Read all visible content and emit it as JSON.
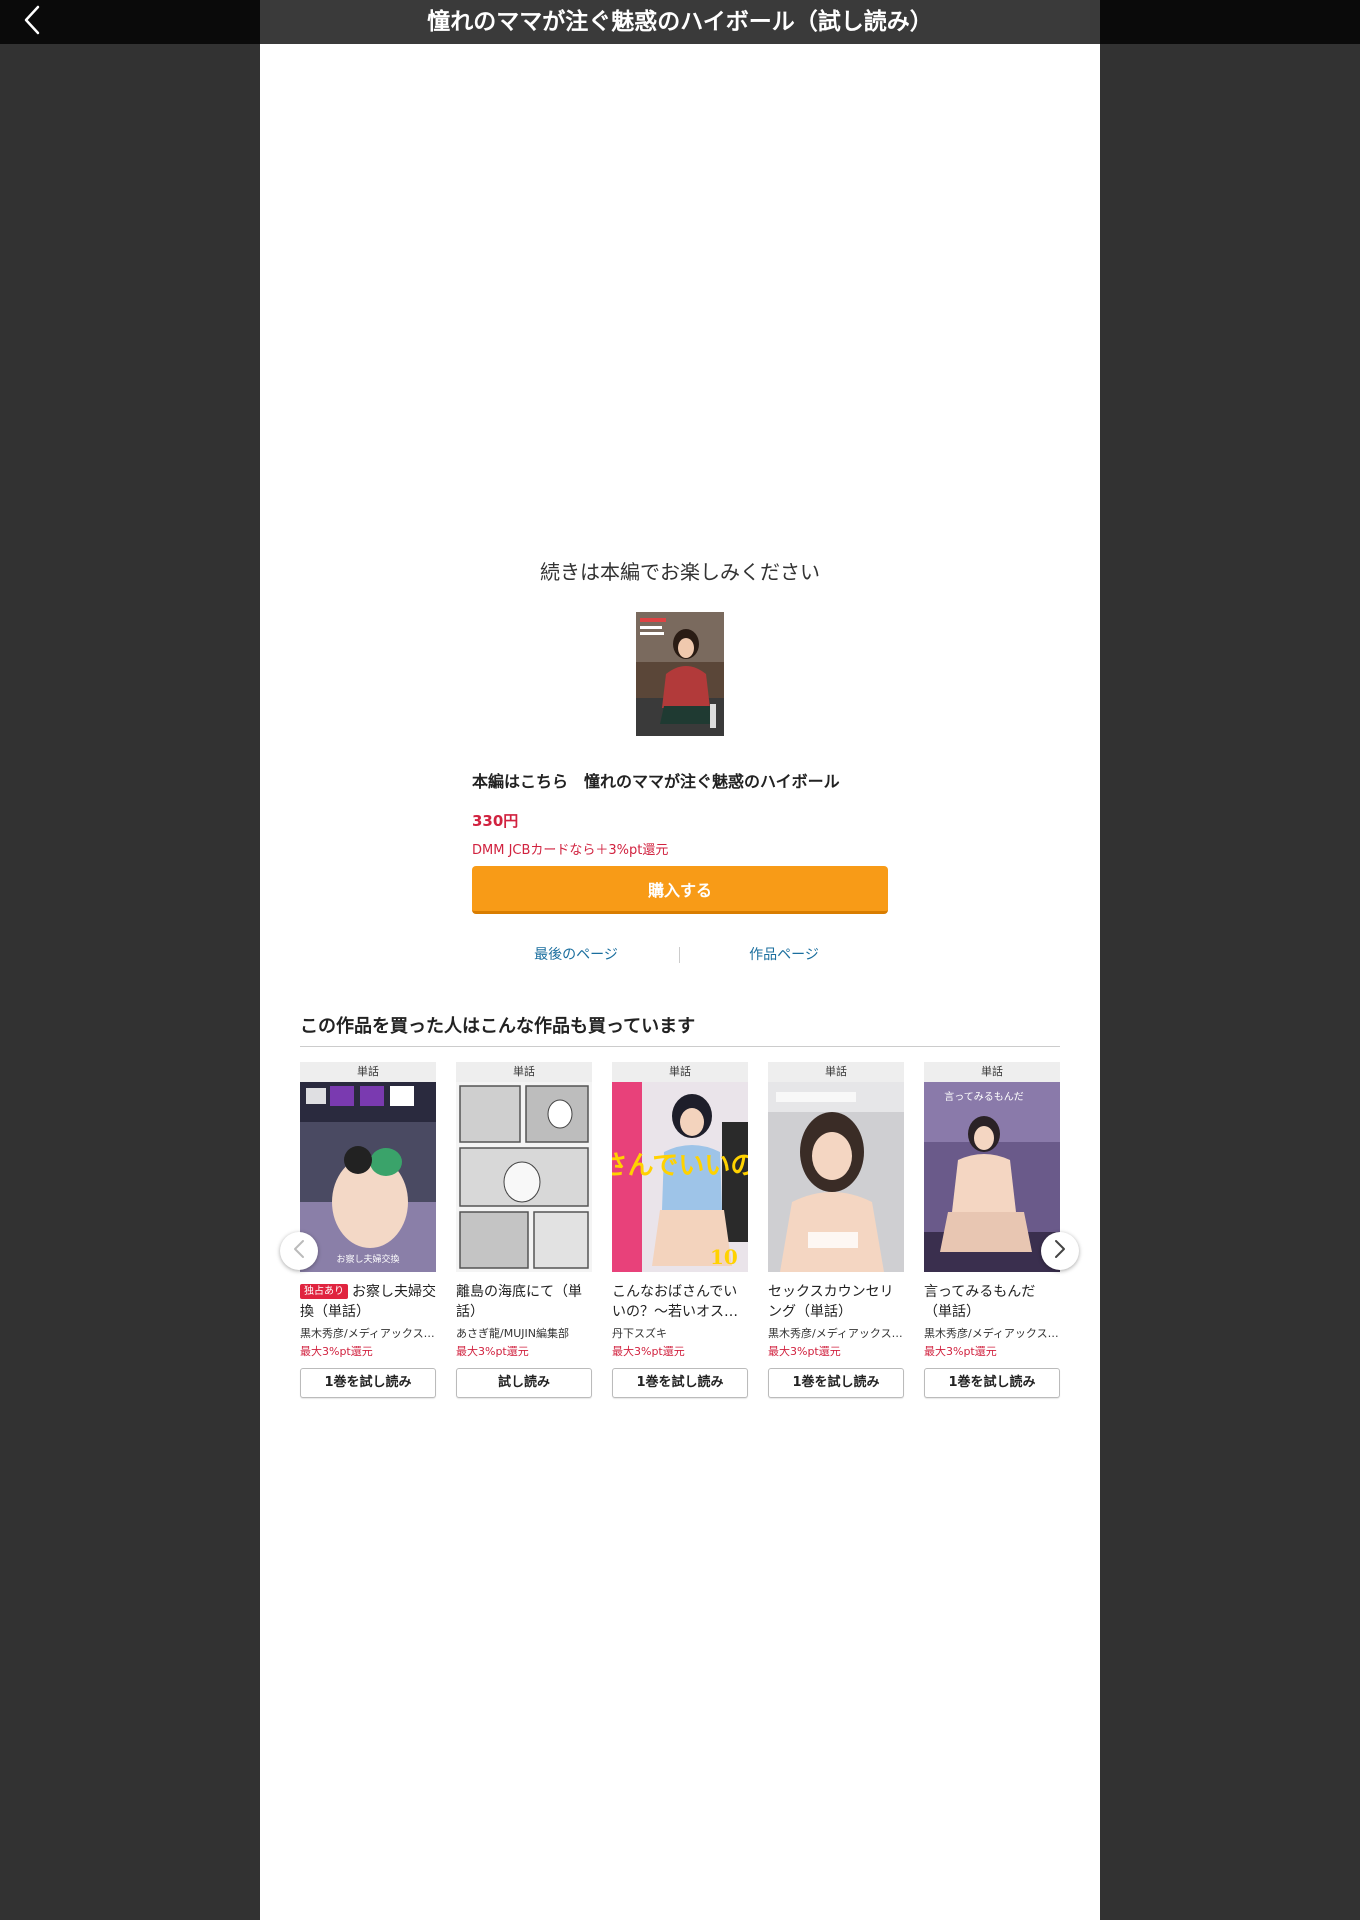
{
  "header": {
    "title": "憧れのママが注ぐ魅惑のハイボール（試し読み）",
    "back_icon": "chevron-left-icon"
  },
  "end_section": {
    "message": "続きは本編でお楽しみください",
    "buy_title": "本編はこちら　憧れのママが注ぐ魅惑のハイボール",
    "price": "330円",
    "jcb_note": "DMM JCBカードなら＋3%pt還元",
    "buy_button": "購入する",
    "link_last_page": "最後のページ",
    "link_work_page": "作品ページ"
  },
  "recommendations": {
    "heading": "この作品を買った人はこんな作品も買っています",
    "items": [
      {
        "type": "単話",
        "badge": "独占あり",
        "title": "お察し夫婦交換（単話）",
        "cover_text": "お察し夫婦交換",
        "author": "黒木秀彦/メディアックス…",
        "point": "最大3%pt還元",
        "button": "1巻を試し読み"
      },
      {
        "type": "単話",
        "badge": "",
        "title": "離島の海底にて（単話）",
        "cover_text": "",
        "author": "あさぎ龍/MUJIN編集部",
        "point": "最大3%pt還元",
        "button": "試し読み"
      },
      {
        "type": "単話",
        "badge": "",
        "title": "こんなおばさんでいいの？〜若いオス…",
        "cover_text": "こんなおばさんでいいの？",
        "author": "丹下スズキ",
        "point": "最大3%pt還元",
        "button": "1巻を試し読み"
      },
      {
        "type": "単話",
        "badge": "",
        "title": "セックスカウンセリング（単話）",
        "cover_text": "",
        "author": "黒木秀彦/メディアックス…",
        "point": "最大3%pt還元",
        "button": "1巻を試し読み"
      },
      {
        "type": "単話",
        "badge": "",
        "title": "言ってみるもんだ（単話）",
        "cover_text": "言ってみるもんだ",
        "author": "黒木秀彦/メディアックス…",
        "point": "最大3%pt還元",
        "button": "1巻を試し読み"
      }
    ],
    "prev_icon": "chevron-left-icon",
    "next_icon": "chevron-right-icon"
  },
  "colors": {
    "accent_orange": "#f89b17",
    "price_red": "#d1223f",
    "link_blue": "#1a6e9e",
    "background": "#323232"
  }
}
